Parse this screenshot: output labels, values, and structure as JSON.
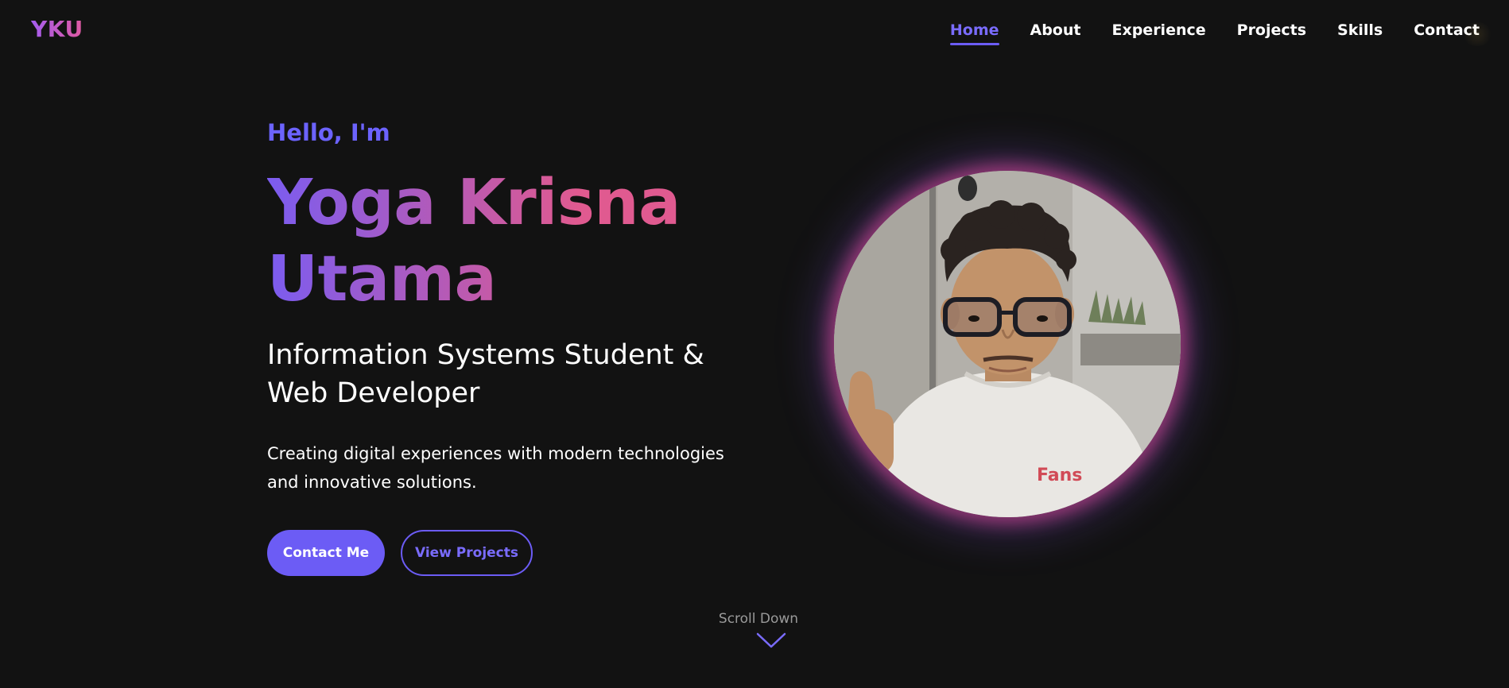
{
  "nav": {
    "logo": "YKU",
    "links": [
      {
        "label": "Home",
        "active": true
      },
      {
        "label": "About"
      },
      {
        "label": "Experience"
      },
      {
        "label": "Projects"
      },
      {
        "label": "Skills"
      },
      {
        "label": "Contact"
      }
    ]
  },
  "hero": {
    "greeting": "Hello, I'm",
    "name": "Yoga Krisna Utama",
    "role": "Information Systems Student & Web Developer",
    "tagline": "Creating digital experiences with modern technologies and innovative solutions.",
    "primary_button": "Contact Me",
    "secondary_button": "View Projects"
  },
  "scroll": {
    "label": "Scroll Down",
    "icon": "chevron-down-icon"
  },
  "avatar": {
    "icon": "profile-photo"
  },
  "colors": {
    "background": "#121212",
    "accent": "#6c5cf5",
    "gradient_start": "#7b5cf0",
    "gradient_end": "#e05a90",
    "glow_pink": "#ec4899",
    "glow_purple": "#8b5cf6"
  }
}
